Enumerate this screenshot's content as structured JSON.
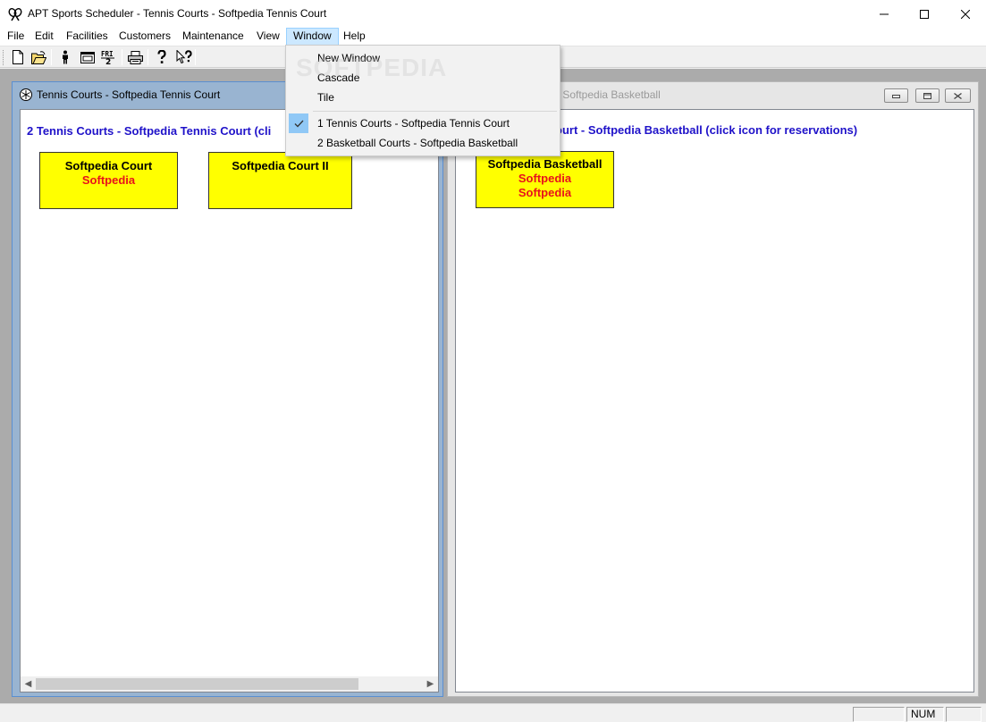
{
  "window": {
    "title": "APT Sports Scheduler - Tennis Courts - Softpedia Tennis Court"
  },
  "menubar": {
    "items": [
      "File",
      "Edit",
      "Facilities",
      "Customers",
      "Maintenance",
      "View",
      "Window",
      "Help"
    ],
    "active": "Window"
  },
  "toolbar": {
    "buttons": [
      "new-icon",
      "open-icon",
      "person-icon",
      "window-icon",
      "calendar-icon",
      "print-icon",
      "help-icon",
      "context-help-icon"
    ],
    "calendar_label": "FRI"
  },
  "window_menu": {
    "items": [
      "New Window",
      "Cascade",
      "Tile"
    ],
    "windows": [
      "1 Tennis Courts - Softpedia Tennis Court",
      "2 Basketball Courts - Softpedia Basketball"
    ],
    "checked_index": 0
  },
  "watermark": "SOFTPEDIA",
  "left_child": {
    "title": "Tennis Courts - Softpedia Tennis Court",
    "heading": "2 Tennis Courts - Softpedia Tennis Court  (cli",
    "courts": [
      {
        "name": "Softpedia Court",
        "subs": [
          "Softpedia"
        ]
      },
      {
        "name": "Softpedia Court II",
        "subs": []
      }
    ]
  },
  "right_child": {
    "title_visible": "- Softpedia Basketball",
    "heading": "ourt - Softpedia Basketball  (click icon for reservations)",
    "courts": [
      {
        "name": "Softpedia Basketball",
        "subs": [
          "Softpedia",
          "Softpedia"
        ]
      }
    ]
  },
  "statusbar": {
    "num": "NUM"
  },
  "colors": {
    "heading": "#1f12c9",
    "court_fill": "#ffff00",
    "court_sub_text": "#e8121b",
    "menu_highlight": "#cce8ff"
  }
}
